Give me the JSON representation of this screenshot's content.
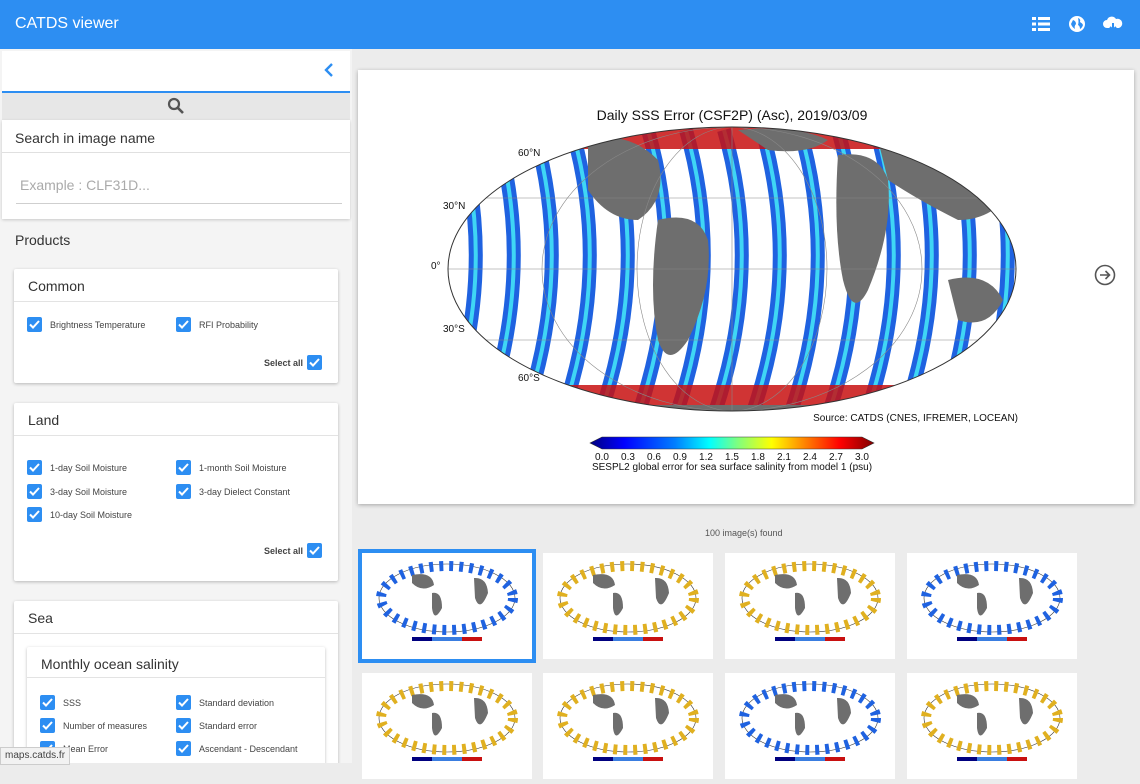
{
  "app_title": "CATDS viewer",
  "search": {
    "label": "Search in image name",
    "placeholder": "Example : CLF31D..."
  },
  "products_label": "Products",
  "groups": {
    "common": {
      "title": "Common",
      "items": [
        "Brightness Temperature",
        "RFI Probability"
      ],
      "select_all": "Select all"
    },
    "land": {
      "title": "Land",
      "items": [
        "1-day Soil Moisture",
        "1-month Soil Moisture",
        "3-day Soil Moisture",
        "3-day Dielect Constant",
        "10-day Soil Moisture"
      ],
      "select_all": "Select all"
    },
    "sea": {
      "title": "Sea",
      "sub_title": "Monthly ocean salinity",
      "items": [
        "SSS",
        "Standard deviation",
        "Number of measures",
        "Standard error",
        "Mean Error",
        "Ascendant - Descendant"
      ]
    }
  },
  "map": {
    "title": "Daily SSS Error (CSF2P) (Asc), 2019/03/09",
    "lat_labels": [
      "60°N",
      "30°N",
      "0°",
      "30°S",
      "60°S"
    ],
    "source": "Source: CATDS (CNES, IFREMER, LOCEAN)",
    "colorbar_ticks": [
      "0.0",
      "0.3",
      "0.6",
      "0.9",
      "1.2",
      "1.5",
      "1.8",
      "2.1",
      "2.4",
      "2.7",
      "3.0"
    ],
    "colorbar_label": "SESPL2 global error for sea surface salinity from model 1 (psu)"
  },
  "images_found": "100 image(s) found",
  "status_url": "maps.catds.fr",
  "colors": {
    "accent": "#2d8ef2",
    "land": "#6e6e6e",
    "ocean_error_scale": [
      "#00007f",
      "#0000ff",
      "#007fff",
      "#00ffff",
      "#7fff7f",
      "#ffff00",
      "#ff7f00",
      "#ff0000",
      "#7f0000"
    ]
  },
  "icons": {
    "top": [
      "list-icon",
      "globe-icon",
      "cloud-download-icon"
    ],
    "collapse": "chevron-left-icon",
    "search": "search-icon",
    "next": "arrow-right-circle-icon"
  }
}
